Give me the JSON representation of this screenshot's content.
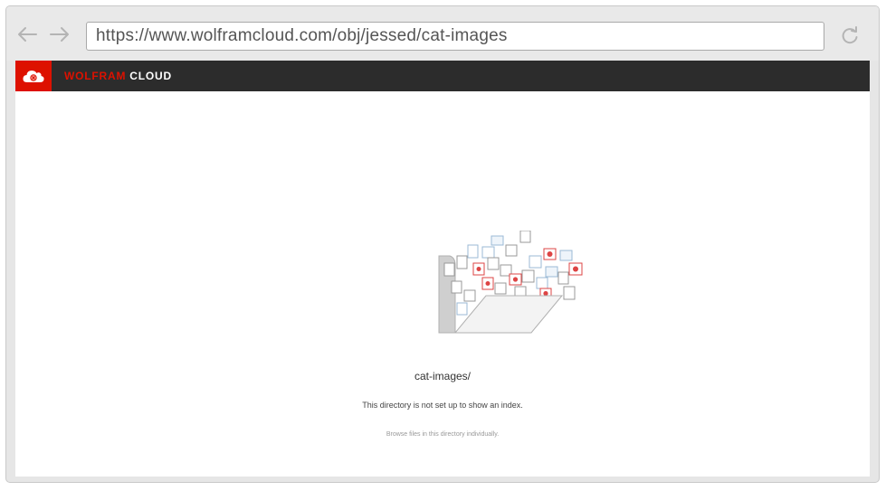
{
  "browser": {
    "url": "https://www.wolframcloud.com/obj/jessed/cat-images",
    "back_icon": "arrow-left-icon",
    "forward_icon": "arrow-right-icon",
    "reload_icon": "reload-icon"
  },
  "header": {
    "logo_icon": "wolfram-cloud-logo-icon",
    "brand_primary": "WOLFRAM",
    "brand_secondary": "CLOUD",
    "brand_color": "#dd1100",
    "bar_color": "#2c2c2c"
  },
  "main": {
    "illustration_icon": "folder-with-files-icon",
    "directory_name": "cat-images/",
    "message": "This directory is not set up to show an index.",
    "browse_link": "Browse files in this directory individually."
  }
}
